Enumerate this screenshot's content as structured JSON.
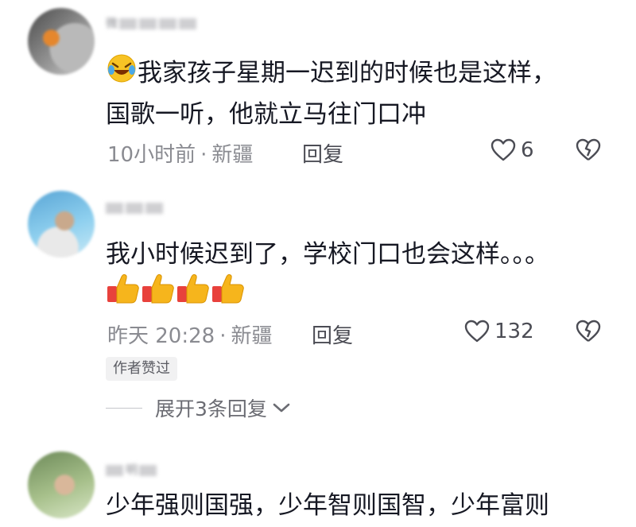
{
  "comments": [
    {
      "username": "微",
      "text_line1": "我家孩子星期一迟到的时候也是这样，",
      "text_line2": "国歌一听，他就立马往门口冲",
      "time": "10小时前",
      "location": "新疆",
      "reply_label": "回复",
      "likes": "6",
      "leading_emoji": "rofl-emoji"
    },
    {
      "username": "",
      "text_line1": "我小时候迟到了，学校门口也会这样。。。",
      "time": "昨天 20:28",
      "location": "新疆",
      "reply_label": "回复",
      "likes": "132",
      "author_tag": "作者赞过",
      "expand_label": "展开3条回复",
      "emoji_row": [
        "thumbs-up-emoji",
        "thumbs-up-emoji",
        "thumbs-up-emoji",
        "thumbs-up-emoji"
      ]
    },
    {
      "username": "明",
      "text_line1": "少年强则国强，少年智则国智，少年富则"
    }
  ],
  "icons": {
    "like": "heart-outline-icon",
    "dislike": "broken-heart-icon",
    "expand": "chevron-down-icon"
  },
  "colors": {
    "primary_text": "#161823",
    "secondary_text": "#8a8b91",
    "tag_bg": "#f1f1f2"
  }
}
